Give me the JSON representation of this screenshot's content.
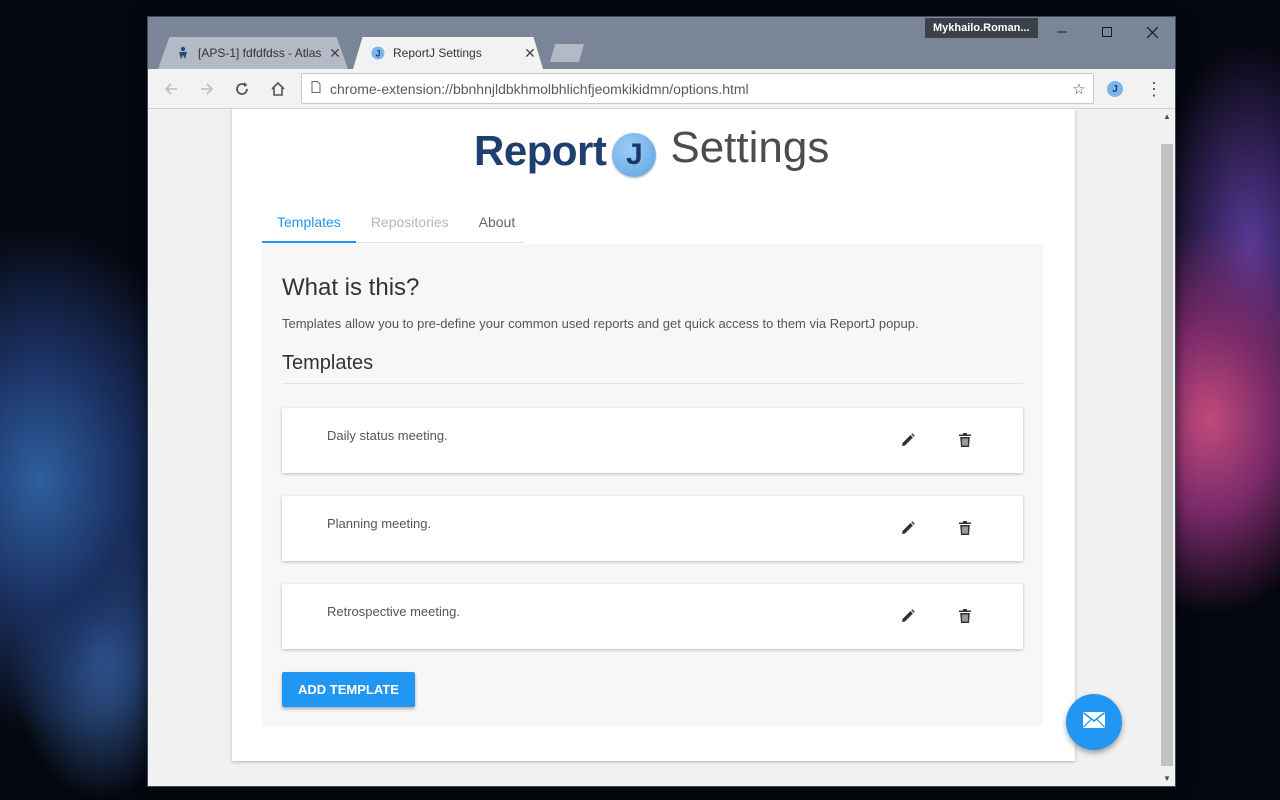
{
  "os": {
    "profile_name": "Mykhailo.Roman..."
  },
  "browser": {
    "tabs": [
      {
        "title": "[APS-1] fdfdfdss - Atlass",
        "favicon": "atlassian-icon",
        "close": "✕"
      },
      {
        "title": "ReportJ Settings",
        "favicon": "reportj-icon",
        "close": "✕"
      }
    ],
    "address": {
      "url": "chrome-extension://bbnhnjldbkhmolbhlichfjeomkikidmn/options.html"
    },
    "extension_label": "J"
  },
  "page": {
    "brand": {
      "report": "Report",
      "j": "J",
      "settings": "Settings"
    },
    "tabs": [
      {
        "label": "Templates",
        "state": "active"
      },
      {
        "label": "Repositories",
        "state": "disabled"
      },
      {
        "label": "About",
        "state": "normal"
      }
    ],
    "what_title": "What is this?",
    "what_desc": "Templates allow you to pre-define your common used reports and get quick access to them via ReportJ popup.",
    "templates_title": "Templates",
    "templates": [
      {
        "name": "Daily status meeting."
      },
      {
        "name": "Planning meeting."
      },
      {
        "name": "Retrospective meeting."
      }
    ],
    "add_button": "ADD TEMPLATE",
    "fab_icon": "envelope-icon"
  },
  "colors": {
    "accent": "#2196f3",
    "brand_dark": "#1f3f6e"
  }
}
